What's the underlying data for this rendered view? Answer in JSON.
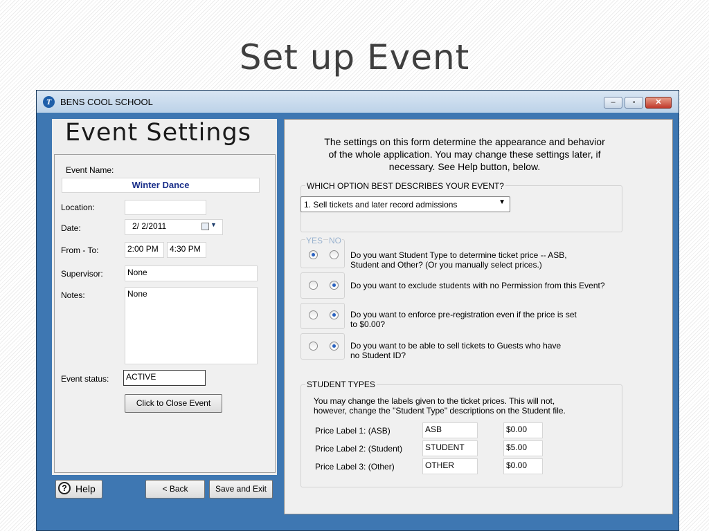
{
  "slide": {
    "title": "Set up Event"
  },
  "window": {
    "title": "BENS COOL SCHOOL",
    "logo_letter": "T",
    "controls": {
      "minimize": "–",
      "maximize": "▫",
      "close": "✕"
    }
  },
  "left": {
    "heading": "Event Settings",
    "event_name_label": "Event Name:",
    "event_name_value": "Winter Dance",
    "location_label": "Location:",
    "location_value": "",
    "date_label": "Date:",
    "date_value": "2/  2/2011",
    "from_to_label": "From - To:",
    "from_value": "2:00 PM",
    "to_value": "4:30 PM",
    "supervisor_label": "Supervisor:",
    "supervisor_value": "None",
    "notes_label": "Notes:",
    "notes_value": "None",
    "status_label": "Event status:",
    "status_value": "ACTIVE",
    "close_event_button": "Click to Close Event"
  },
  "footer": {
    "help_button": "Help",
    "help_icon": "?",
    "back_button": "< Back",
    "save_exit_button": "Save and Exit"
  },
  "right": {
    "intro_lines": [
      "The settings on this form determine the appearance and behavior",
      "of the whole application.  You may change these settings later, if",
      "necessary. See Help button, below."
    ],
    "option_group_caption": "WHICH OPTION BEST DESCRIBES YOUR EVENT?",
    "option_selected": "1. Sell tickets and later record admissions",
    "yes_label": "YES",
    "no_label": "NO",
    "questions": [
      {
        "lines": [
          "Do you want Student Type to determine ticket price -- ASB,",
          "Student and Other? (Or you manually select prices.)"
        ],
        "answer": "yes"
      },
      {
        "lines": [
          "Do you want to exclude students with no Permission from this Event?"
        ],
        "answer": "no"
      },
      {
        "lines": [
          "Do you want to enforce pre-registration even if the price is set",
          "to $0.00?"
        ],
        "answer": "no"
      },
      {
        "lines": [
          "Do you want to be able to sell tickets to Guests who have",
          "no Student ID?"
        ],
        "answer": "no"
      }
    ],
    "student_types": {
      "caption": "STUDENT TYPES",
      "note_lines": [
        "You may change the labels given to the ticket prices. This will not,",
        "however, change the \"Student Type\" descriptions on the Student file."
      ],
      "rows": [
        {
          "label": "Price Label 1: (ASB)",
          "name": "ASB",
          "price": "$0.00"
        },
        {
          "label": "Price Label 2: (Student)",
          "name": "STUDENT",
          "price": "$5.00"
        },
        {
          "label": "Price Label 3: (Other)",
          "name": "OTHER",
          "price": "$0.00"
        }
      ]
    }
  },
  "colors": {
    "frame": "#3e77b2",
    "panel": "#f0f0f0",
    "accent_text": "#1a2f8a",
    "radio_dot": "#2a62c0"
  }
}
